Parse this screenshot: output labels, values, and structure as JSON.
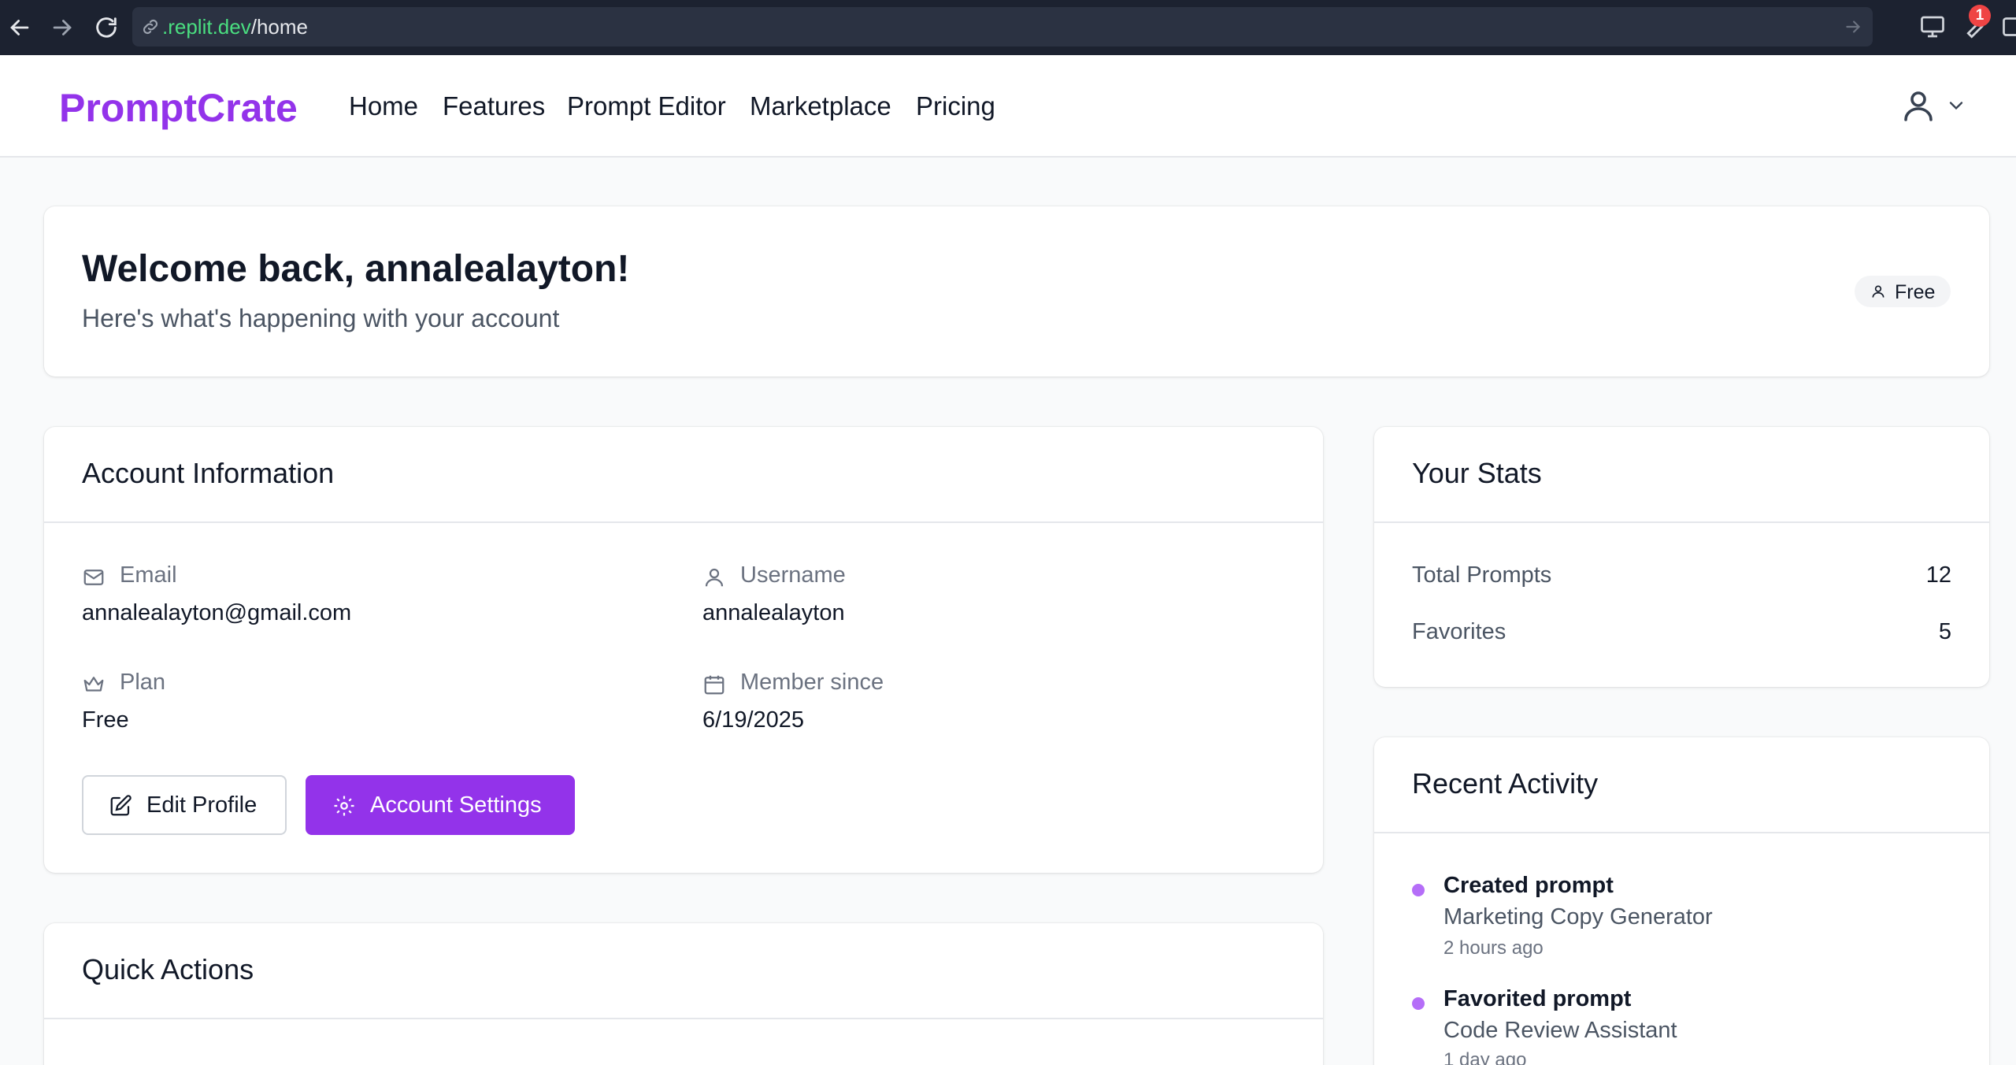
{
  "browser": {
    "url_domain": ".replit.dev",
    "url_path": "/home",
    "notification_count": "1"
  },
  "header": {
    "logo": "PromptCrate",
    "nav": [
      "Home",
      "Features",
      "Prompt Editor",
      "Marketplace",
      "Pricing"
    ]
  },
  "welcome": {
    "title": "Welcome back, annalealayton!",
    "subtitle": "Here's what's happening with your account",
    "plan_badge": "Free"
  },
  "account": {
    "title": "Account Information",
    "email_label": "Email",
    "email_value": "annalealayton@gmail.com",
    "username_label": "Username",
    "username_value": "annalealayton",
    "plan_label": "Plan",
    "plan_value": "Free",
    "member_label": "Member since",
    "member_value": "6/19/2025",
    "edit_button": "Edit Profile",
    "settings_button": "Account Settings"
  },
  "quick_actions": {
    "title": "Quick Actions"
  },
  "stats": {
    "title": "Your Stats",
    "items": [
      {
        "label": "Total Prompts",
        "value": "12"
      },
      {
        "label": "Favorites",
        "value": "5"
      }
    ]
  },
  "activity": {
    "title": "Recent Activity",
    "items": [
      {
        "action": "Created prompt",
        "target": "Marketing Copy Generator",
        "time": "2 hours ago"
      },
      {
        "action": "Favorited prompt",
        "target": "Code Review Assistant",
        "time": "1 day ago"
      }
    ]
  },
  "colors": {
    "brand": "#9333ea",
    "chrome_bg": "#1c2230",
    "url_domain": "#4ade80",
    "activity_dot": "#a855f7"
  }
}
